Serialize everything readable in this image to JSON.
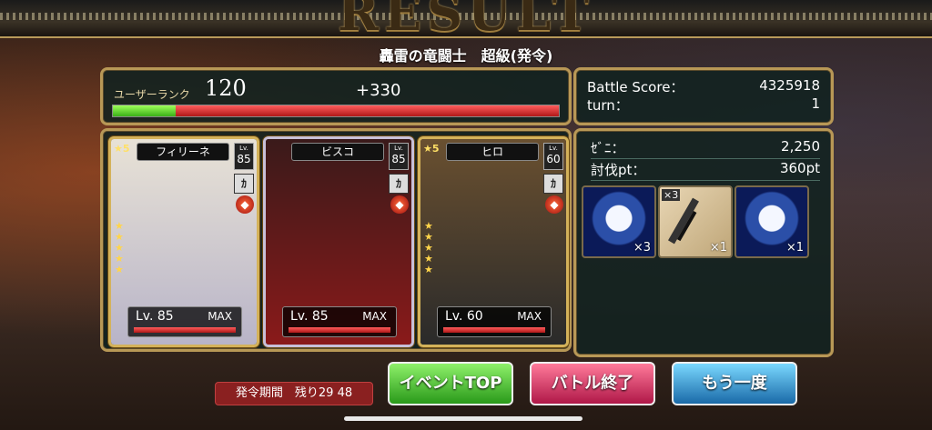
{
  "header": {
    "title": "RESULT",
    "subtitle": "轟雷の竜闘士　超級(発令)"
  },
  "rank": {
    "label": "ユーザーランク",
    "value": "120",
    "gain": "+330",
    "exp_fill": 0.14
  },
  "score": {
    "battle_label": "Battle Score：",
    "battle_value": "4325918",
    "turn_label": "turn：",
    "turn_value": "1"
  },
  "cards": [
    {
      "name": "フィリーネ",
      "rarity": "★5",
      "lv_tag": "Lv.",
      "lv_num": "85",
      "level": "Lv. 85",
      "max": "MAX",
      "colors": [
        "#e8e2d6",
        "#b8b4c8"
      ]
    },
    {
      "name": "ビスコ",
      "rarity": "",
      "lv_tag": "Lv.",
      "lv_num": "85",
      "level": "Lv. 85",
      "max": "MAX",
      "colors": [
        "#3a1a1a",
        "#8a1a1a"
      ]
    },
    {
      "name": "ヒロ",
      "rarity": "★5",
      "lv_tag": "Lv.",
      "lv_num": "60",
      "level": "Lv. 60",
      "max": "MAX",
      "colors": [
        "#6a5030",
        "#2a2a2a"
      ]
    }
  ],
  "rewards": {
    "money_label": "ｾﾞﾆ：",
    "money_value": "2,250",
    "pt_label": "討伐pt：",
    "pt_value": "360pt",
    "items": [
      {
        "icon": "dragon-medal-icon",
        "qty": "×3"
      },
      {
        "icon": "rifle-weapon-icon",
        "qty": "×1",
        "tag": "×3"
      },
      {
        "icon": "dragon-medal-icon",
        "qty": "×1"
      }
    ]
  },
  "footer": {
    "countdown": "発令期間　残り29 48",
    "event_top": "イベントTOP",
    "battle_end": "バトル終了",
    "again": "もう一度"
  }
}
